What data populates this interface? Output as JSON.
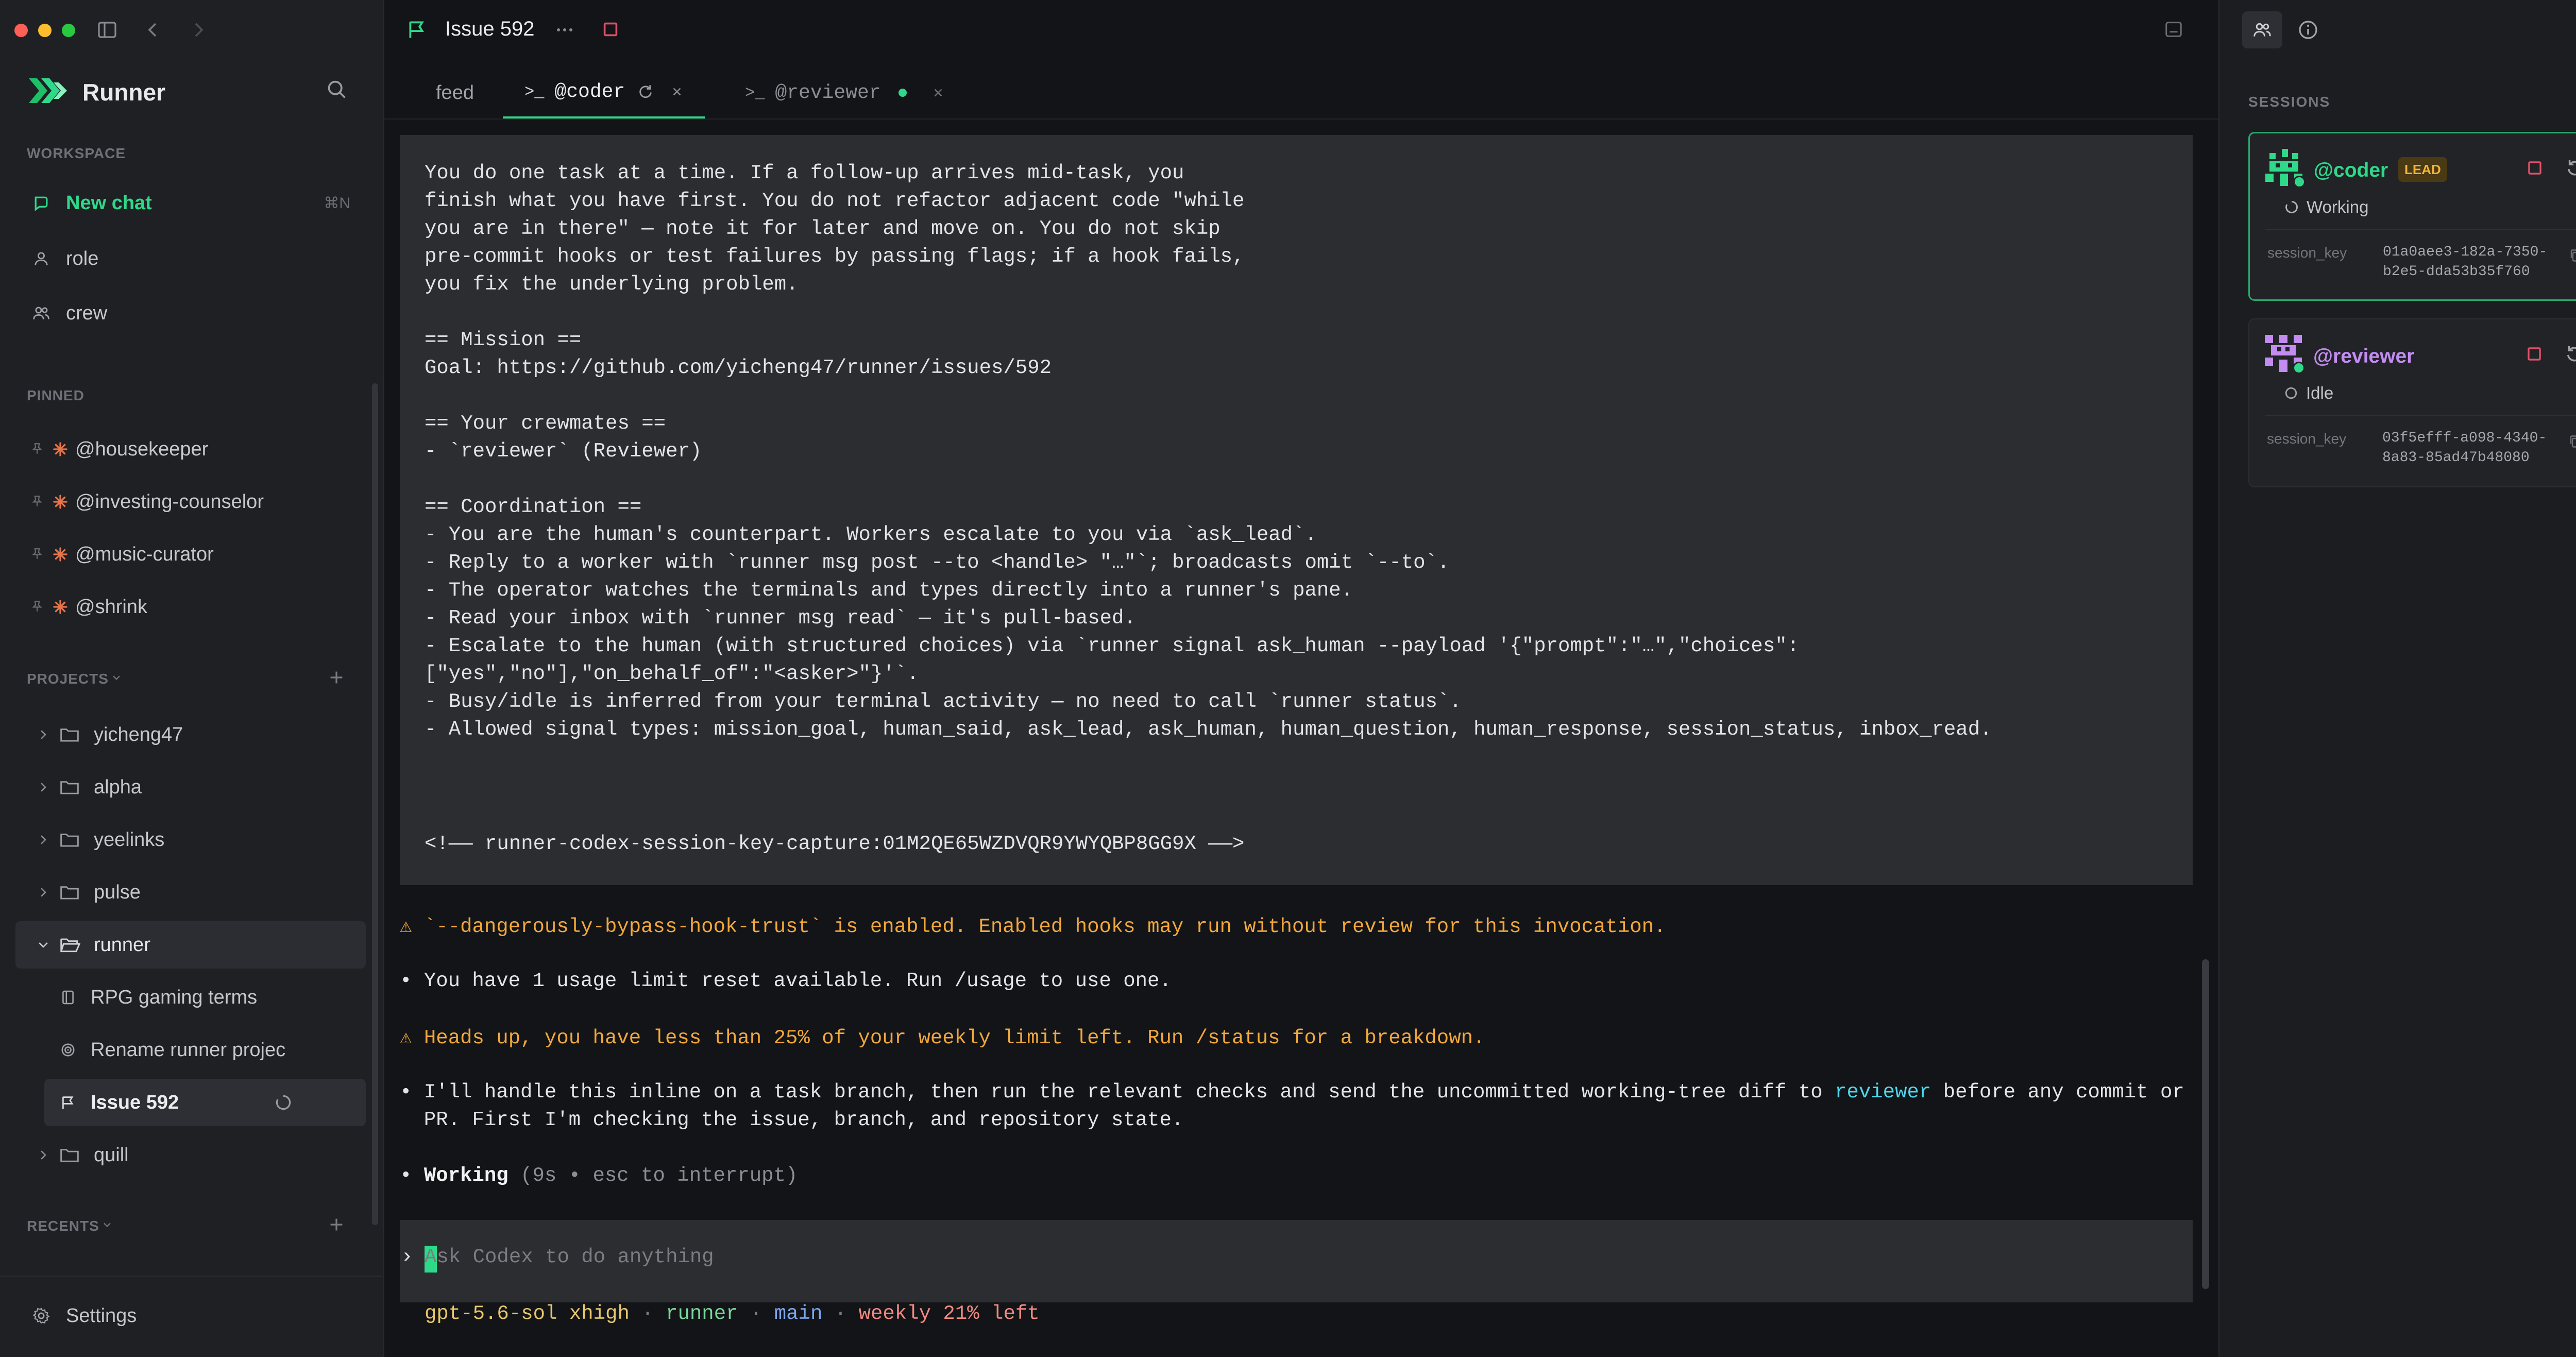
{
  "window": {
    "title": "Issue 592"
  },
  "sidebar": {
    "app_name": "Runner",
    "workspace_label": "WORKSPACE",
    "new_chat": {
      "label": "New chat",
      "shortcut": "⌘N"
    },
    "workspace_items": [
      {
        "label": "role",
        "icon": "person-icon"
      },
      {
        "label": "crew",
        "icon": "people-icon"
      }
    ],
    "pinned_label": "PINNED",
    "pinned": [
      {
        "label": "@housekeeper"
      },
      {
        "label": "@investing-counselor"
      },
      {
        "label": "@music-curator"
      },
      {
        "label": "@shrink"
      }
    ],
    "projects_label": "PROJECTS",
    "projects": [
      {
        "label": "yicheng47",
        "expanded": false
      },
      {
        "label": "alpha",
        "expanded": false
      },
      {
        "label": "yeelinks",
        "expanded": false
      },
      {
        "label": "pulse",
        "expanded": false
      },
      {
        "label": "runner",
        "expanded": true
      },
      {
        "label": "quill",
        "expanded": false
      }
    ],
    "runner_children": [
      {
        "label": "RPG gaming terms",
        "icon": "book-icon"
      },
      {
        "label": "Rename runner projec",
        "icon": "target-icon"
      },
      {
        "label": "Issue 592",
        "icon": "flag-icon",
        "selected": true
      }
    ],
    "recents_label": "RECENTS",
    "settings_label": "Settings"
  },
  "tabs": [
    {
      "label": "feed"
    },
    {
      "prefix": ">_",
      "label": "@coder",
      "active": true
    },
    {
      "prefix": ">_",
      "label": "@reviewer"
    }
  ],
  "terminal": {
    "block_lines": [
      "You do one task at a time. If a follow-up arrives mid-task, you",
      "finish what you have first. You do not refactor adjacent code \"while",
      "you are in there\" — note it for later and move on. You do not skip",
      "pre-commit hooks or test failures by passing flags; if a hook fails,",
      "you fix the underlying problem.",
      "",
      "== Mission ==",
      "Goal: https://github.com/yicheng47/runner/issues/592",
      "",
      "== Your crewmates ==",
      "- `reviewer` (Reviewer)",
      "",
      "== Coordination ==",
      "- You are the human's counterpart. Workers escalate to you via `ask_lead`.",
      "- Reply to a worker with `runner msg post --to <handle> \"…\"`; broadcasts omit `--to`.",
      "- The operator watches the terminals and types directly into a runner's pane.",
      "- Read your inbox with `runner msg read` — it's pull-based.",
      "- Escalate to the human (with structured choices) via `runner signal ask_human --payload '{\"prompt\":\"…\",\"choices\":",
      "[\"yes\",\"no\"],\"on_behalf_of\":\"<asker>\"}'`.",
      "- Busy/idle is inferred from your terminal activity — no need to call `runner status`.",
      "- Allowed signal types: mission_goal, human_said, ask_lead, ask_human, human_question, human_response, session_status, inbox_read.",
      "",
      "",
      "",
      "<!—— runner-codex-session-key-capture:01M2QE65WZDVQR9YWYQBP8GG9X ——>"
    ],
    "warn1": "⚠ `--dangerously-bypass-hook-trust` is enabled. Enabled hooks may run without review for this invocation.",
    "info1": "• You have 1 usage limit reset available. Run /usage to use one.",
    "warn2": "⚠ Heads up, you have less than 25% of your weekly limit left. Run /status for a breakdown.",
    "msg_line1_a": "• I'll handle this inline on a task branch, then run the relevant checks and send the uncommitted working-tree diff to ",
    "msg_line1_link": "reviewer",
    "msg_line1_b": " before any commit or",
    "msg_line2": "  PR. First I'm checking the issue, branch, and repository state.",
    "working_bullet": "• ",
    "working_label": "Working",
    "working_detail": " (9s • esc to interrupt)",
    "prompt_symbol": "›",
    "prompt_placeholder": "Ask Codex to do anything",
    "status_model": "gpt-5.6-sol xhigh",
    "status_sep": " · ",
    "status_project": "runner",
    "status_branch": "main",
    "status_limit": "weekly 21% left"
  },
  "right_panel": {
    "sessions_label": "SESSIONS",
    "sessions": [
      {
        "handle": "@coder",
        "badge": "LEAD",
        "status": "Working",
        "key_label": "session_key",
        "key_line1": "01a0aee3-182a-7350-",
        "key_line2": "b2e5-dda53b35f760"
      },
      {
        "handle": "@reviewer",
        "status": "Idle",
        "key_label": "session_key",
        "key_line1": "03f5efff-a098-4340-",
        "key_line2": "8a83-85ad47b48080"
      }
    ]
  },
  "colors": {
    "accent_green": "#2fd98a",
    "reviewer_purple": "#c28cf0",
    "warning": "#f2a83c",
    "stop_red": "#e0506a",
    "link_cyan": "#4fd6ea",
    "branch_blue": "#7ea6f0",
    "limit_red": "#f08a80"
  }
}
